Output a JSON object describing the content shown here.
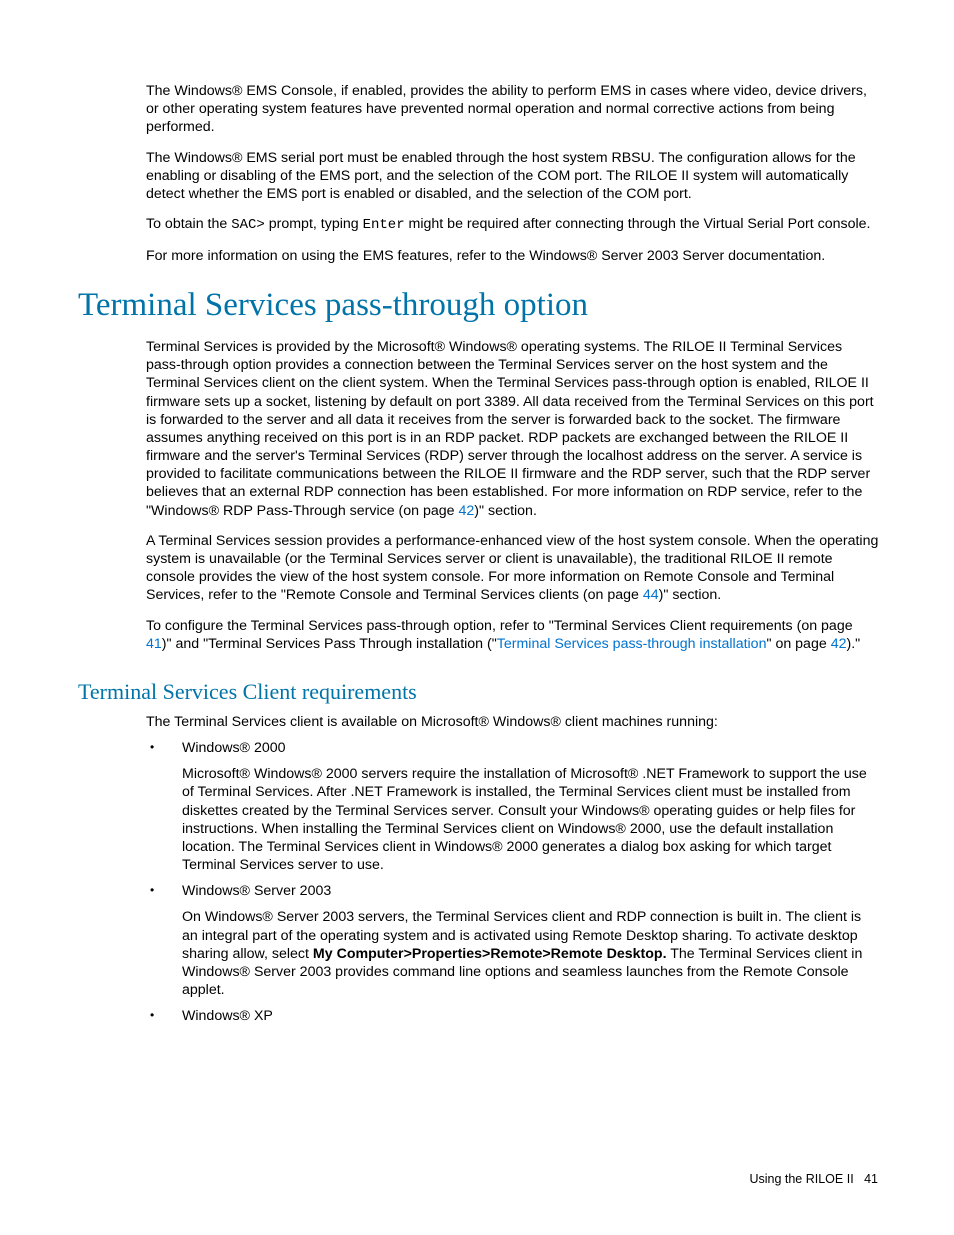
{
  "para1": "The Windows® EMS Console, if enabled, provides the ability to perform EMS in cases where video, device drivers, or other operating system features have prevented normal operation and normal corrective actions from being performed.",
  "para2": "The Windows® EMS serial port must be enabled through the host system RBSU. The configuration allows for the enabling or disabling of the EMS port, and the selection of the COM port. The RILOE II system will automatically detect whether the EMS port is enabled or disabled, and the selection of the COM port.",
  "para3_a": "To obtain the ",
  "para3_code1": "SAC>",
  "para3_b": " prompt, typing ",
  "para3_code2": "Enter",
  "para3_c": " might be required after connecting through the Virtual Serial Port console.",
  "para4": "For more information on using the EMS features, refer to the Windows® Server 2003 Server documentation.",
  "h1": "Terminal Services pass-through option",
  "para5_a": "Terminal Services is provided by the Microsoft® Windows® operating systems. The RILOE II Terminal Services pass-through option provides a connection between the Terminal Services server on the host system and the Terminal Services client on the client system. When the Terminal Services pass-through option is enabled, RILOE II firmware sets up a socket, listening by default on port 3389. All data received from the Terminal Services on this port is forwarded to the server and all data it receives from the server is forwarded back to the socket. The firmware assumes anything received on this port is in an RDP packet. RDP packets are exchanged between the RILOE II firmware and the server's Terminal Services (RDP) server through the localhost address on the server. A service is provided to facilitate communications between the RILOE II firmware and the RDP server, such that the RDP server believes that an external RDP connection has been established. For more information on RDP service, refer to the \"Windows® RDP Pass-Through service (on page ",
  "para5_link1": "42",
  "para5_b": ")\" section.",
  "para6_a": "A Terminal Services session provides a performance-enhanced view of the host system console. When the operating system is unavailable (or the Terminal Services server or client is unavailable), the traditional RILOE II remote console provides the view of the host system console. For more information on Remote Console and Terminal Services, refer to the \"Remote Console and Terminal Services clients (on page ",
  "para6_link1": "44",
  "para6_b": ")\" section.",
  "para7_a": "To configure the Terminal Services pass-through option, refer to \"Terminal Services Client requirements (on page ",
  "para7_link1": "41",
  "para7_b": ")\" and \"Terminal Services Pass Through installation (\"",
  "para7_link2": "Terminal Services pass-through installation",
  "para7_c": "\" on page ",
  "para7_link3": "42",
  "para7_d": ").\"",
  "h2": "Terminal Services Client requirements",
  "para8": "The Terminal Services client is available on Microsoft® Windows® client machines running:",
  "li1_head": "Windows® 2000",
  "li1_body": "Microsoft® Windows® 2000 servers require the installation of Microsoft® .NET Framework to support the use of Terminal Services. After .NET Framework is installed, the Terminal Services client must be installed from diskettes created by the Terminal Services server. Consult your Windows® operating guides or help files for instructions. When installing the Terminal Services client on Windows® 2000, use the default installation location. The Terminal Services client in Windows® 2000 generates a dialog box asking for which target Terminal Services server to use.",
  "li2_head": "Windows® Server 2003",
  "li2_body_a": "On Windows® Server 2003 servers, the Terminal Services client and RDP connection is built in. The client is an integral part of the operating system and is activated using Remote Desktop sharing. To activate desktop sharing allow, select ",
  "li2_bold": "My Computer>Properties>Remote>Remote Desktop.",
  "li2_body_b": " The Terminal Services client in Windows® Server 2003 provides command line options and seamless launches from the Remote Console applet.",
  "li3_head": "Windows® XP",
  "footer_a": "Using the RILOE II",
  "footer_b": "41"
}
